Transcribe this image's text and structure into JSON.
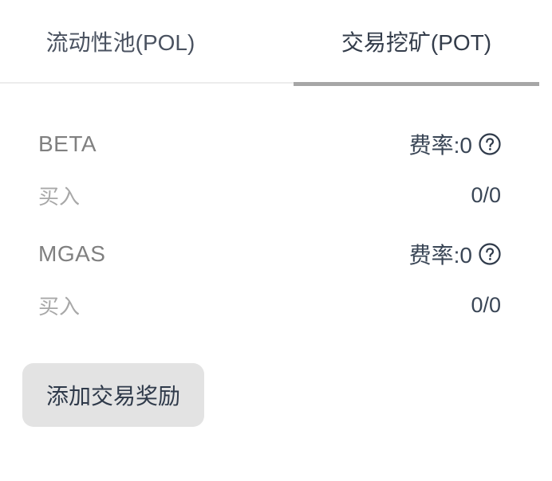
{
  "tabs": [
    {
      "label": "流动性池(POL)",
      "active": false
    },
    {
      "label": "交易挖矿(POT)",
      "active": true
    }
  ],
  "pools": [
    {
      "token": "BETA",
      "fee_label": "费率:0",
      "action_label": "买入",
      "amount": "0/0"
    },
    {
      "token": "MGAS",
      "fee_label": "费率:0",
      "action_label": "买入",
      "amount": "0/0"
    }
  ],
  "add_reward_button": {
    "label": "添加交易奖励"
  },
  "colors": {
    "tab_indicator": "#a6a6a6",
    "button_bg": "#e3e3e3",
    "muted_text": "#a8a8a8",
    "token_text": "#808080",
    "primary_text": "#3a4656"
  },
  "icons": {
    "help": "question-circle-icon"
  }
}
